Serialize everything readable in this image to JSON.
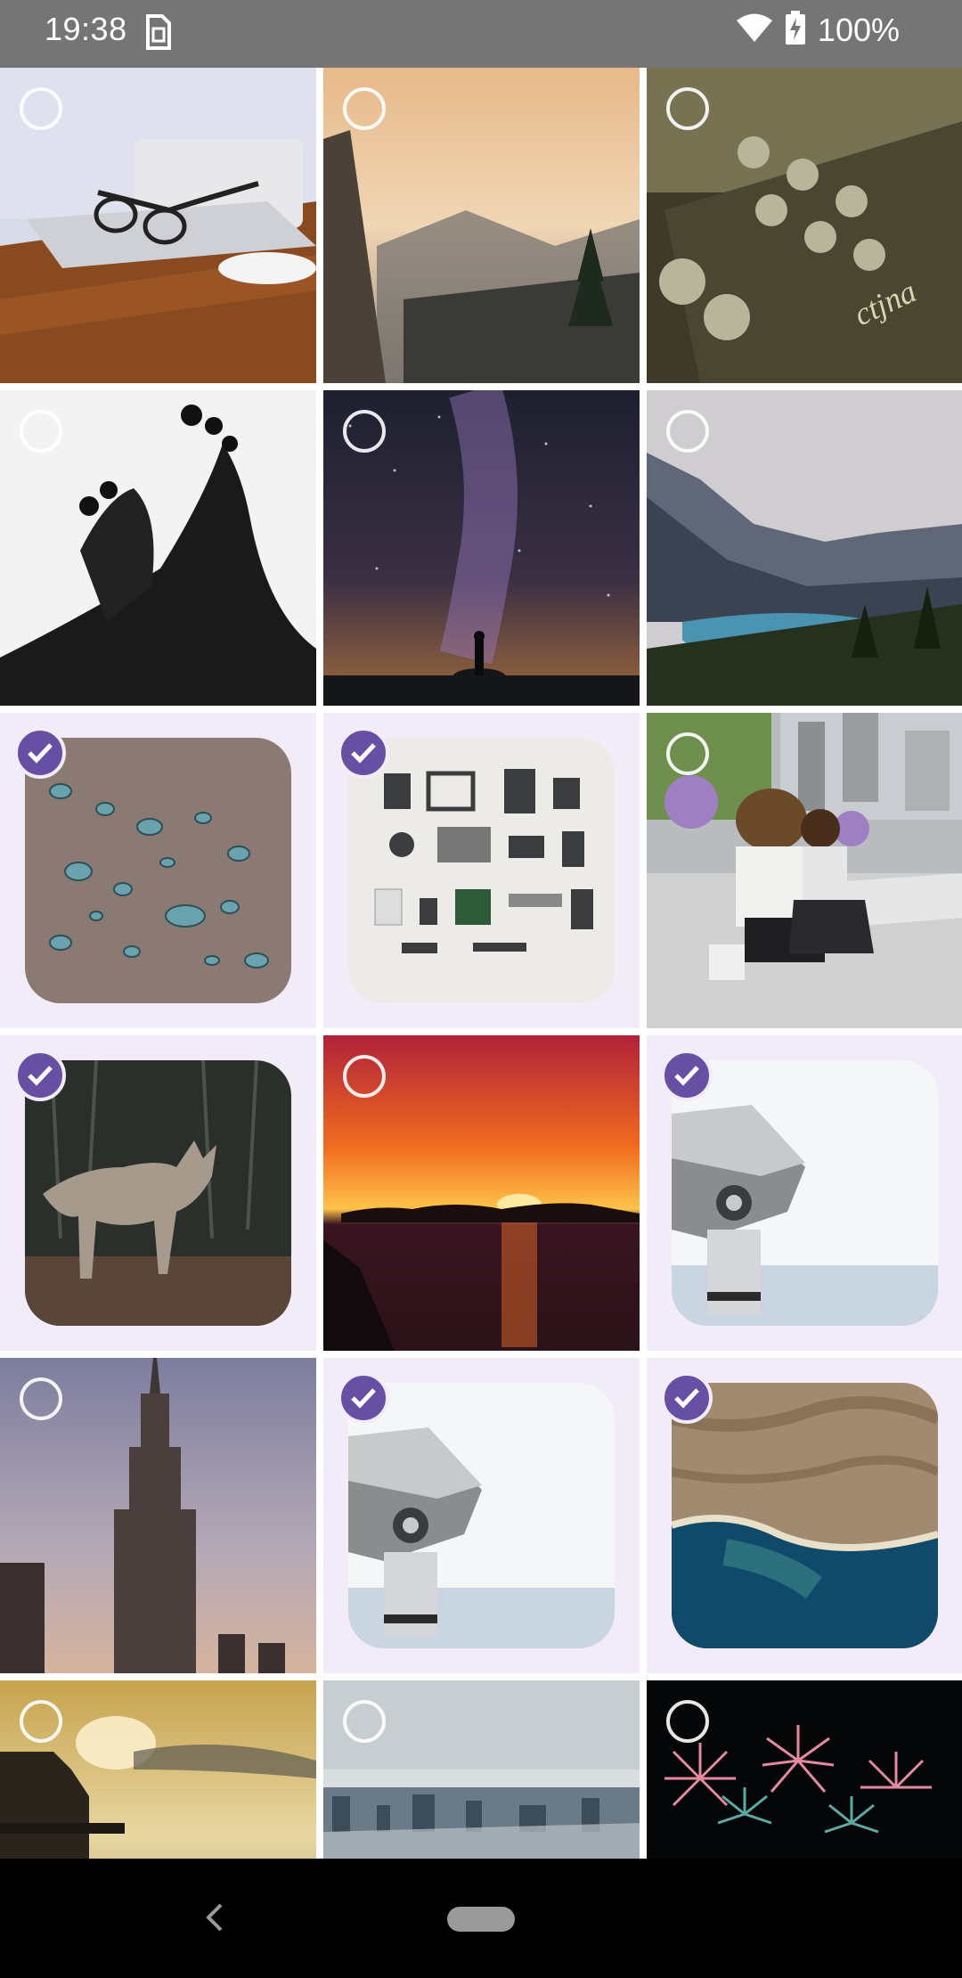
{
  "status_bar": {
    "time": "19:38",
    "battery_text": "100%",
    "icons": [
      "sim-icon",
      "wifi-icon",
      "battery-charging-icon"
    ]
  },
  "theme": {
    "accent": "#6750a4",
    "selected_tile_bg": "#f1ecf8",
    "status_bar_bg": "#757575",
    "nav_bar_bg": "#000000"
  },
  "photo_grid": {
    "columns": 3,
    "items": [
      {
        "subject": "laptop-glasses-desk",
        "selected": false
      },
      {
        "subject": "mountain-valley-sunrise",
        "selected": false
      },
      {
        "subject": "guitar-headstock",
        "selected": false
      },
      {
        "subject": "feet-silhouette",
        "selected": false
      },
      {
        "subject": "milky-way-night-sky",
        "selected": false
      },
      {
        "subject": "lake-mountains",
        "selected": false
      },
      {
        "subject": "water-droplets",
        "selected": true
      },
      {
        "subject": "disassembled-camera-parts",
        "selected": true
      },
      {
        "subject": "mother-daughter-street",
        "selected": false
      },
      {
        "subject": "coyote",
        "selected": true
      },
      {
        "subject": "ocean-sunset",
        "selected": false
      },
      {
        "subject": "tower-viewer-binoculars",
        "selected": true
      },
      {
        "subject": "empire-state-building",
        "selected": false
      },
      {
        "subject": "tower-viewer-binoculars",
        "selected": true
      },
      {
        "subject": "aerial-coastline",
        "selected": true
      },
      {
        "subject": "pier-sunset",
        "selected": false
      },
      {
        "subject": "city-skyline-winter",
        "selected": false
      },
      {
        "subject": "fireworks",
        "selected": false
      }
    ]
  },
  "nav_bar": {
    "buttons": [
      "back-icon",
      "home-pill"
    ]
  }
}
